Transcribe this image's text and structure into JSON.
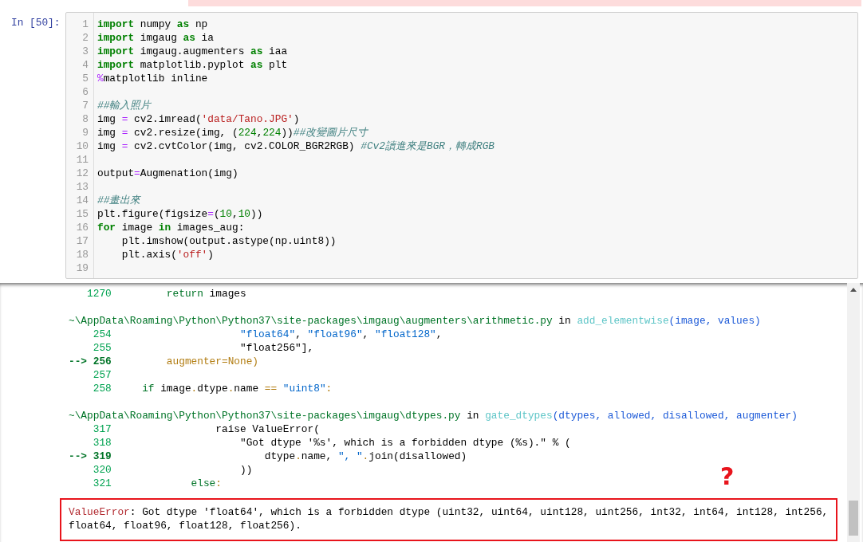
{
  "cell": {
    "prompt": "In [50]:",
    "lines": [
      {
        "number": "1",
        "tokens": [
          {
            "kind": "keyword",
            "text": "import"
          },
          {
            "kind": "plain",
            "text": " numpy "
          },
          {
            "kind": "keyword",
            "text": "as"
          },
          {
            "kind": "plain",
            "text": " np"
          }
        ]
      },
      {
        "number": "2",
        "tokens": [
          {
            "kind": "keyword",
            "text": "import"
          },
          {
            "kind": "plain",
            "text": " imgaug "
          },
          {
            "kind": "keyword",
            "text": "as"
          },
          {
            "kind": "plain",
            "text": " ia"
          }
        ]
      },
      {
        "number": "3",
        "tokens": [
          {
            "kind": "keyword",
            "text": "import"
          },
          {
            "kind": "plain",
            "text": " imgaug.augmenters "
          },
          {
            "kind": "keyword",
            "text": "as"
          },
          {
            "kind": "plain",
            "text": " iaa"
          }
        ]
      },
      {
        "number": "4",
        "tokens": [
          {
            "kind": "keyword",
            "text": "import"
          },
          {
            "kind": "plain",
            "text": " matplotlib.pyplot "
          },
          {
            "kind": "keyword",
            "text": "as"
          },
          {
            "kind": "plain",
            "text": " plt"
          }
        ]
      },
      {
        "number": "5",
        "tokens": [
          {
            "kind": "operator",
            "text": "%"
          },
          {
            "kind": "plain",
            "text": "matplotlib inline"
          }
        ]
      },
      {
        "number": "6"
      },
      {
        "number": "7",
        "tokens": [
          {
            "kind": "comment",
            "text": "##輸入照片"
          }
        ]
      },
      {
        "number": "8",
        "tokens": [
          {
            "kind": "plain",
            "text": "img "
          },
          {
            "kind": "operator",
            "text": "="
          },
          {
            "kind": "plain",
            "text": " cv2.imread("
          },
          {
            "kind": "string",
            "text": "'data/Tano.JPG'"
          },
          {
            "kind": "plain",
            "text": ")"
          }
        ]
      },
      {
        "number": "9",
        "tokens": [
          {
            "kind": "plain",
            "text": "img "
          },
          {
            "kind": "operator",
            "text": "="
          },
          {
            "kind": "plain",
            "text": " cv2.resize(img, ("
          },
          {
            "kind": "number",
            "text": "224"
          },
          {
            "kind": "plain",
            "text": ","
          },
          {
            "kind": "number",
            "text": "224"
          },
          {
            "kind": "plain",
            "text": "))"
          },
          {
            "kind": "comment",
            "text": "##改變圖片尺寸"
          }
        ]
      },
      {
        "number": "10",
        "tokens": [
          {
            "kind": "plain",
            "text": "img "
          },
          {
            "kind": "operator",
            "text": "="
          },
          {
            "kind": "plain",
            "text": " cv2.cvtColor(img, cv2.COLOR_BGR2RGB) "
          },
          {
            "kind": "comment",
            "text": "#Cv2讀進來是BGR，轉成RGB"
          }
        ]
      },
      {
        "number": "11"
      },
      {
        "number": "12",
        "tokens": [
          {
            "kind": "plain",
            "text": "output"
          },
          {
            "kind": "operator",
            "text": "="
          },
          {
            "kind": "plain",
            "text": "Augmenation(img)"
          }
        ]
      },
      {
        "number": "13"
      },
      {
        "number": "14",
        "tokens": [
          {
            "kind": "comment",
            "text": "##畫出來"
          }
        ]
      },
      {
        "number": "15",
        "tokens": [
          {
            "kind": "plain",
            "text": "plt.figure(figsize"
          },
          {
            "kind": "operator",
            "text": "="
          },
          {
            "kind": "plain",
            "text": "("
          },
          {
            "kind": "number",
            "text": "10"
          },
          {
            "kind": "plain",
            "text": ","
          },
          {
            "kind": "number",
            "text": "10"
          },
          {
            "kind": "plain",
            "text": "))"
          }
        ]
      },
      {
        "number": "16",
        "tokens": [
          {
            "kind": "keyword",
            "text": "for"
          },
          {
            "kind": "plain",
            "text": " image "
          },
          {
            "kind": "keyword",
            "text": "in"
          },
          {
            "kind": "plain",
            "text": " images_aug:"
          }
        ]
      },
      {
        "number": "17",
        "tokens": [
          {
            "kind": "plain",
            "text": "    plt.imshow(output.astype(np.uint8))"
          }
        ]
      },
      {
        "number": "18",
        "tokens": [
          {
            "kind": "plain",
            "text": "    plt.axis("
          },
          {
            "kind": "string",
            "text": "'off'"
          },
          {
            "kind": "plain",
            "text": ")"
          }
        ]
      },
      {
        "number": "19"
      }
    ]
  },
  "traceback": [
    {
      "lines": [
        {
          "number": "1270",
          "current": false,
          "tokens": [
            {
              "kind": "keyword",
              "text": "        return"
            },
            {
              "kind": "plain",
              "text": " images"
            }
          ]
        }
      ]
    },
    {
      "file": "~\\AppData\\Roaming\\Python\\Python37\\site-packages\\imgaug\\augmenters\\arithmetic.py",
      "in_word": "in",
      "function": "add_elementwise",
      "args": "(image, values)",
      "lines": [
        {
          "number": "254",
          "current": false,
          "tokens": [
            {
              "kind": "string",
              "text": "                    \"float64\""
            },
            {
              "kind": "plain",
              "text": ", "
            },
            {
              "kind": "string",
              "text": "\"float96\""
            },
            {
              "kind": "plain",
              "text": ", "
            },
            {
              "kind": "string",
              "text": "\"float128\""
            },
            {
              "kind": "plain",
              "text": ","
            }
          ]
        },
        {
          "number": "255",
          "current": false,
          "tokens": [
            {
              "kind": "plain",
              "text": "                    \"float256\"],"
            }
          ]
        },
        {
          "number": "256",
          "current": true,
          "arrow": "-->",
          "tokens": [
            {
              "kind": "accent",
              "text": "        augmenter=None)"
            }
          ]
        },
        {
          "number": "257",
          "current": false
        },
        {
          "number": "258",
          "current": false,
          "tokens": [
            {
              "kind": "keyword",
              "text": "    if"
            },
            {
              "kind": "plain",
              "text": " image"
            },
            {
              "kind": "operator",
              "text": "."
            },
            {
              "kind": "plain",
              "text": "dtype"
            },
            {
              "kind": "operator",
              "text": "."
            },
            {
              "kind": "plain",
              "text": "name "
            },
            {
              "kind": "operator",
              "text": "=="
            },
            {
              "kind": "string",
              "text": " \"uint8\""
            },
            {
              "kind": "operator",
              "text": ":"
            }
          ]
        }
      ]
    },
    {
      "file": "~\\AppData\\Roaming\\Python\\Python37\\site-packages\\imgaug\\dtypes.py",
      "in_word": "in",
      "function": "gate_dtypes",
      "args": "(dtypes, allowed, disallowed, augmenter)",
      "lines": [
        {
          "number": "317",
          "current": false,
          "tokens": [
            {
              "kind": "plain",
              "text": "                raise ValueError("
            }
          ]
        },
        {
          "number": "318",
          "current": false,
          "tokens": [
            {
              "kind": "plain",
              "text": "                    \"Got dtype '%s', which is a forbidden dtype (%s).\" % ("
            }
          ]
        },
        {
          "number": "319",
          "current": true,
          "arrow": "-->",
          "tokens": [
            {
              "kind": "plain",
              "text": "                        dtype"
            },
            {
              "kind": "operator",
              "text": "."
            },
            {
              "kind": "plain",
              "text": "name, "
            },
            {
              "kind": "string",
              "text": "\", \""
            },
            {
              "kind": "operator",
              "text": "."
            },
            {
              "kind": "plain",
              "text": "join(disallowed)"
            }
          ]
        },
        {
          "number": "320",
          "current": false,
          "tokens": [
            {
              "kind": "plain",
              "text": "                    ))"
            }
          ]
        },
        {
          "number": "321",
          "current": false,
          "tokens": [
            {
              "kind": "keyword",
              "text": "            else"
            },
            {
              "kind": "operator",
              "text": ":"
            }
          ]
        }
      ]
    }
  ],
  "error": {
    "name": "ValueError",
    "message": ": Got dtype 'float64', which is a forbidden dtype (uint32, uint64, uint128, uint256, int32, int64, int128, int256, float64, float96, float128, float256)."
  },
  "annotation": "?"
}
